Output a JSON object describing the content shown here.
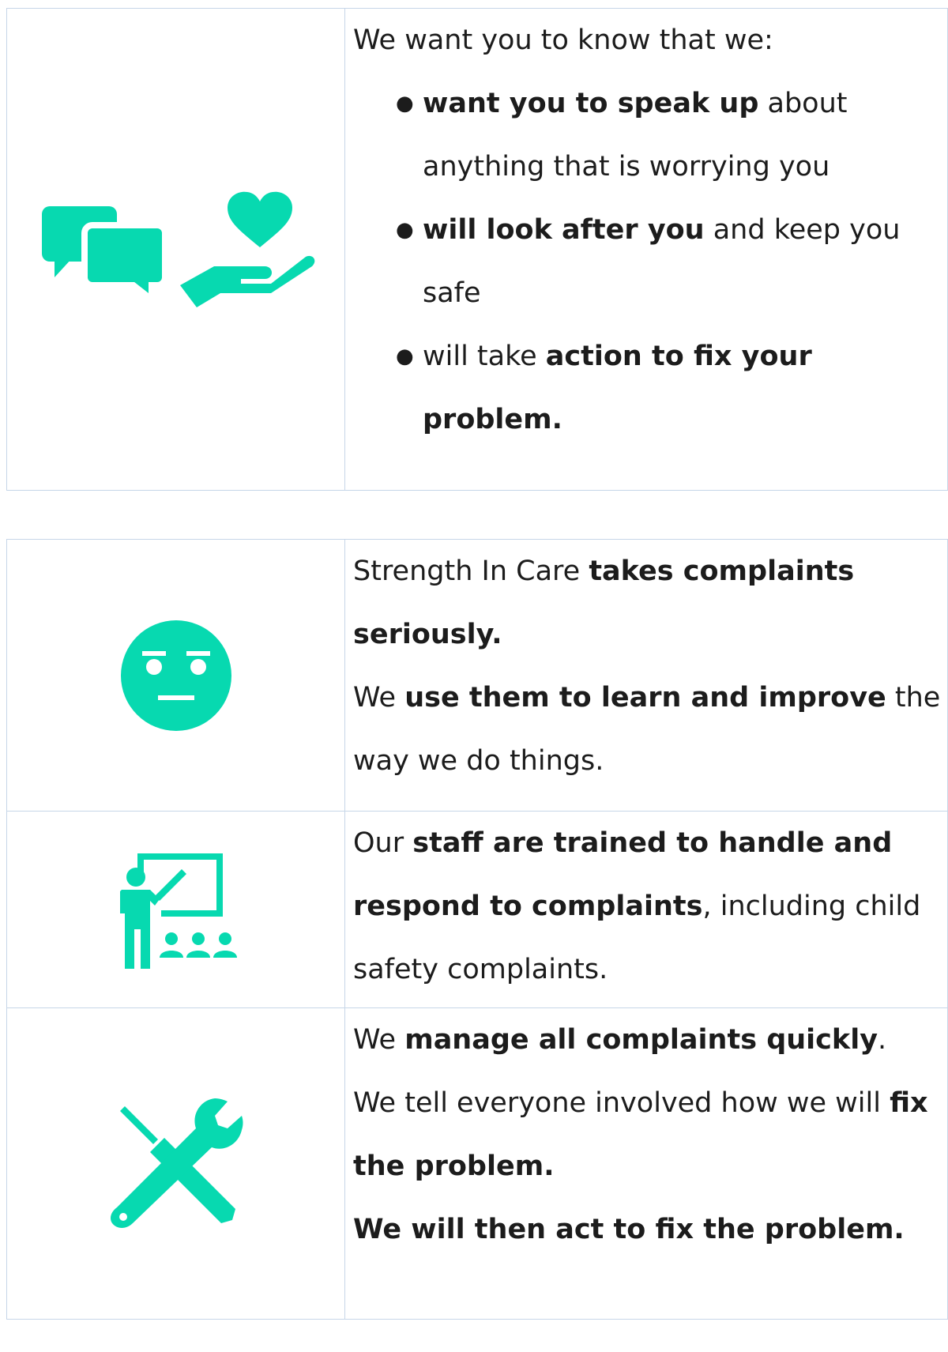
{
  "colors": {
    "accent": "#07d9b0",
    "border": "#c6d6e8",
    "text": "#1c1c1c"
  },
  "section1": {
    "icon": "speech-bubbles-and-caring-hand-icon",
    "intro": "We want you to know that we:",
    "bullets": [
      {
        "bold": "want you to speak up",
        "rest": " about anything that is worrying you"
      },
      {
        "bold": "will look after you",
        "rest": " and keep you safe"
      },
      {
        "pre": "will take ",
        "bold": "action to fix your problem."
      }
    ]
  },
  "section2": {
    "icon": "neutral-face-icon",
    "line1_pre": "Strength In Care ",
    "line1_bold": "takes complaints seriously.",
    "line2_pre": "We ",
    "line2_bold": "use them to learn and improve",
    "line2_post": " the way we do things."
  },
  "section3": {
    "icon": "teacher-training-icon",
    "pre": "Our ",
    "bold": "staff are trained to handle and respond to complaints",
    "post": ", including child safety complaints."
  },
  "section4": {
    "icon": "screwdriver-and-wrench-icon",
    "line1_pre": "We ",
    "line1_bold": "manage all complaints quickly",
    "line1_post": ".",
    "line2_pre": "We tell everyone involved how we will ",
    "line2_bold": "fix the problem.",
    "line3_bold": "We will then act to fix the problem."
  }
}
